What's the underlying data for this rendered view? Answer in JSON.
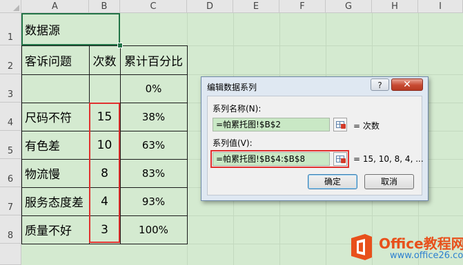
{
  "spreadsheet": {
    "columns": [
      "A",
      "B",
      "C",
      "D",
      "E",
      "F",
      "G",
      "H",
      "I"
    ],
    "rows": [
      "1",
      "2",
      "3",
      "4",
      "5",
      "6",
      "7",
      "8"
    ],
    "a1": "数据源",
    "headers": {
      "a": "客诉问题",
      "b": "次数",
      "c": "累计百分比"
    },
    "c3": "0%",
    "data_rows": [
      {
        "problem": "尺码不符",
        "count": "15",
        "pct": "38%"
      },
      {
        "problem": "有色差",
        "count": "10",
        "pct": "63%"
      },
      {
        "problem": "物流慢",
        "count": "8",
        "pct": "83%"
      },
      {
        "problem": "服务态度差",
        "count": "4",
        "pct": "93%"
      },
      {
        "problem": "质量不好",
        "count": "3",
        "pct": "100%"
      }
    ]
  },
  "dialog": {
    "title": "编辑数据系列",
    "help_label": "?",
    "close_label": "✕",
    "series_name_label": "系列名称(N):",
    "series_name_value": "=帕累托图!$B$2",
    "series_name_result": "= 次数",
    "series_values_label": "系列值(V):",
    "series_values_value": "=帕累托图!$B$4:$B$8",
    "series_values_result": "= 15, 10, 8, 4, ...",
    "ok_label": "确定",
    "cancel_label": "取消",
    "picker_icon": "range-picker-icon"
  },
  "watermark": {
    "line1": "Office教程网",
    "line2": "www.office26.com"
  },
  "colors": {
    "grid_bg": "#d4ead0",
    "highlight_red": "#e0302e",
    "excel_green": "#217346",
    "watermark_orange": "#e8501b"
  }
}
